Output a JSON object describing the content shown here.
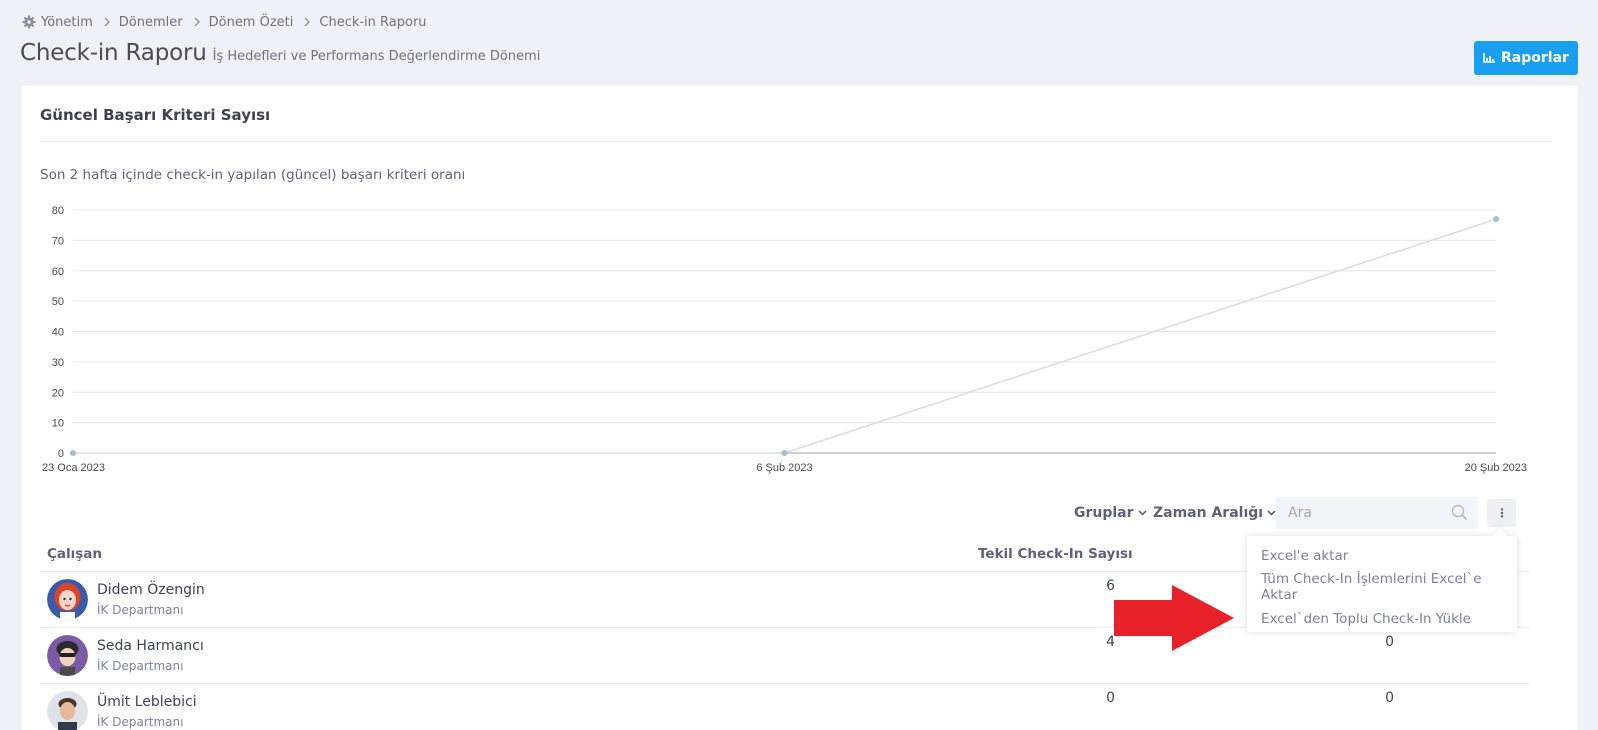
{
  "breadcrumb": {
    "items": [
      {
        "label": "Yönetim",
        "icon": "gear-icon"
      },
      {
        "label": "Dönemler"
      },
      {
        "label": "Dönem Özeti"
      },
      {
        "label": "Check-in Raporu"
      }
    ]
  },
  "header": {
    "title": "Check-in Raporu",
    "subtitle": "İş Hedefleri ve Performans Değerlendirme Dönemi",
    "reports_button": {
      "label": "Raporlar",
      "icon": "chart-icon",
      "color": "#1a9ff0"
    }
  },
  "card": {
    "title": "Güncel Başarı Kriteri Sayısı",
    "chart_caption": "Son 2 hafta içinde check-in yapılan (güncel) başarı kriteri oranı"
  },
  "chart_data": {
    "type": "line",
    "x": [
      "23 Oca 2023",
      "6 Şub 2023",
      "20 Şub 2023"
    ],
    "series": [
      {
        "values": [
          0,
          0,
          77
        ],
        "color": "#9dbfd4"
      }
    ],
    "ylim": [
      0,
      80
    ],
    "yticks": [
      0,
      10,
      20,
      30,
      40,
      50,
      60,
      70,
      80
    ],
    "grid": true,
    "legend": "none"
  },
  "toolbar": {
    "groups_label": "Gruplar",
    "time_range_label": "Zaman Aralığı",
    "search_placeholder": "Ara",
    "more_icon": "vertical-dots-icon"
  },
  "dropdown_menu": {
    "items": [
      "Excel'e aktar",
      "Tüm Check-In İşlemlerini Excel`e Aktar",
      "Excel`den Toplu Check-In Yükle"
    ]
  },
  "table": {
    "columns": [
      "Çalışan",
      "Tekil Check-In Sayısı"
    ],
    "rows": [
      {
        "name": "Didem Özengin",
        "department": "İK Departmanı",
        "unique_checkins": "6",
        "other": ""
      },
      {
        "name": "Seda Harmancı",
        "department": "İK Departmanı",
        "unique_checkins": "4",
        "other": "0"
      },
      {
        "name": "Ümit Leblebici",
        "department": "İK Departmanı",
        "unique_checkins": "0",
        "other": "0"
      }
    ]
  },
  "annotation": {
    "arrow_color": "#e8202a"
  }
}
